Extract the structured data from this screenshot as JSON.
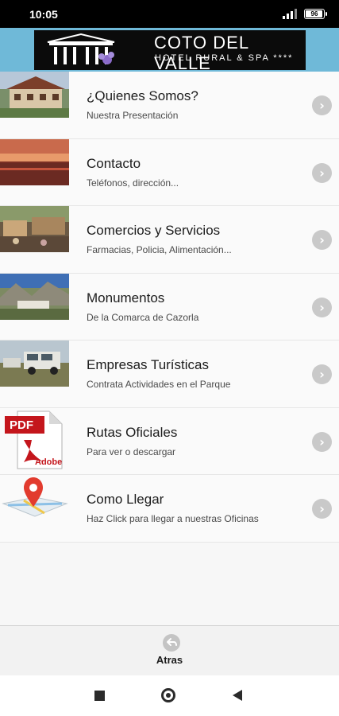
{
  "status_bar": {
    "time": "10:05",
    "battery": "96",
    "icons": [
      "signal-icon",
      "battery-icon"
    ]
  },
  "header": {
    "logo_title": "COTO DEL VALLE",
    "logo_subtitle": "HOTEL RURAL & SPA ****",
    "background_color": "#6fb9d8"
  },
  "menu": {
    "items": [
      {
        "title": "¿Quienes Somos?",
        "subtitle": "Nuestra Presentación",
        "thumb": "hotel-photo"
      },
      {
        "title": "Contacto",
        "subtitle": "Teléfonos, dirección...",
        "thumb": "sunset-photo"
      },
      {
        "title": "Comercios y Servicios",
        "subtitle": "Farmacias, Policia, Alimentación...",
        "thumb": "street-photo"
      },
      {
        "title": "Monumentos",
        "subtitle": "De la Comarca de Cazorla",
        "thumb": "village-photo"
      },
      {
        "title": "Empresas Turísticas",
        "subtitle": "Contrata Actividades en el Parque",
        "thumb": "jeeps-photo"
      },
      {
        "title": "Rutas Oficiales",
        "subtitle": "Para ver o descargar",
        "thumb": "pdf-icon",
        "pdf_label": "PDF",
        "adobe_label": "Adobe"
      },
      {
        "title": "Como Llegar",
        "subtitle": "Haz Click para llegar a nuestras Oficinas",
        "thumb": "map-pin-icon"
      }
    ]
  },
  "footer": {
    "back_label": "Atras"
  }
}
